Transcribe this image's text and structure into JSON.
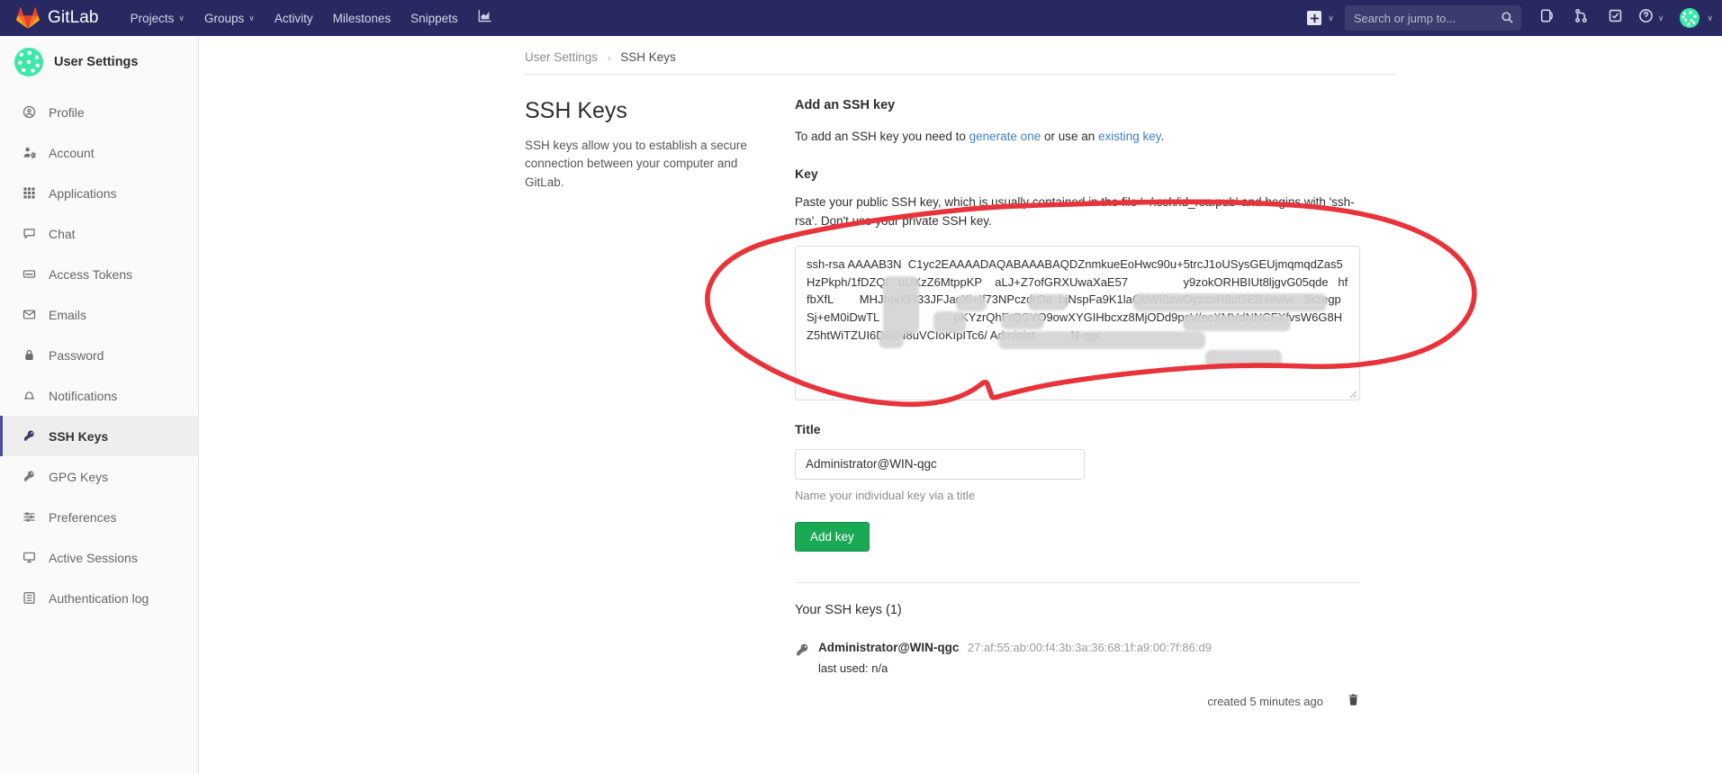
{
  "topnav": {
    "brand": "GitLab",
    "brand_logo_icon": "gitlab-tanuki-logo",
    "items": [
      {
        "label": "Projects",
        "caret": "∨"
      },
      {
        "label": "Groups",
        "caret": "∨"
      },
      {
        "label": "Activity",
        "caret": ""
      },
      {
        "label": "Milestones",
        "caret": ""
      },
      {
        "label": "Snippets",
        "caret": ""
      }
    ],
    "analytics_icon": "bar-chart-icon",
    "plus_icon": "plus-square-icon",
    "plus_caret": "∨",
    "search": {
      "value": "",
      "placeholder": "Search or jump to..."
    },
    "right_icons": [
      {
        "name": "issues-icon"
      },
      {
        "name": "merge-requests-icon"
      },
      {
        "name": "todos-icon"
      },
      {
        "name": "help-icon"
      }
    ],
    "help_caret": "∨",
    "avatar_caret": "∨",
    "colors": {
      "nav_bg": "#292961",
      "search_bg": "#3b3b6d",
      "avatar": "#3ce8a8"
    }
  },
  "sidebar": {
    "title": "User Settings",
    "avatar_icon": "user-identicon-avatar",
    "items": [
      {
        "label": "Profile",
        "icon": "user-circle-icon",
        "active": false
      },
      {
        "label": "Account",
        "icon": "account-gear-icon",
        "active": false
      },
      {
        "label": "Applications",
        "icon": "applications-grid-icon",
        "active": false
      },
      {
        "label": "Chat",
        "icon": "chat-bubble-icon",
        "active": false
      },
      {
        "label": "Access Tokens",
        "icon": "token-card-icon",
        "active": false
      },
      {
        "label": "Emails",
        "icon": "envelope-icon",
        "active": false
      },
      {
        "label": "Password",
        "icon": "lock-icon",
        "active": false
      },
      {
        "label": "Notifications",
        "icon": "bell-icon",
        "active": false
      },
      {
        "label": "SSH Keys",
        "icon": "key-icon",
        "active": true
      },
      {
        "label": "GPG Keys",
        "icon": "key-outline-icon",
        "active": false
      },
      {
        "label": "Preferences",
        "icon": "sliders-icon",
        "active": false
      },
      {
        "label": "Active Sessions",
        "icon": "monitor-icon",
        "active": false
      },
      {
        "label": "Authentication log",
        "icon": "log-list-icon",
        "active": false
      }
    ],
    "active_accent": "#4b4ba3"
  },
  "breadcrumb": {
    "parent": "User Settings",
    "separator": "›",
    "current": "SSH Keys"
  },
  "left": {
    "heading": "SSH Keys",
    "description": "SSH keys allow you to establish a secure connection between your computer and GitLab."
  },
  "form": {
    "heading": "Add an SSH key",
    "intro_pre": "To add an SSH key you need to ",
    "intro_link1": "generate one",
    "intro_mid": " or use an ",
    "intro_link2": "existing key",
    "intro_post": ".",
    "key_label": "Key",
    "key_hint": "Paste your public SSH key, which is usually contained in the file '~/.ssh/id_rsa.pub' and begins with 'ssh-rsa'. Don't use your private SSH key.",
    "key_value": "ssh-rsa AAAAB3N  C1yc2EAAAADAQABAAABAQDZnmkueEoHwc90u+5trcJ1oUSysGEUjmqmqdZas5HzPkph/1fDZQI   uUXzZ6MtppKP    aLJ+Z7ofGRXUwaXaE57                 y9zokORHBIUt8ljgvG05qde   hffbXfL        MHJhpiXFI33JFJacXi+If73NPczdrOa  bjNspFa9K1laObWI0zwOyzzuH8uI5EB4ov/w   3xzegpSj+eM0iDwTL                       pKYzrQhFrQSYO9owXYGIHbcxz8MjODd9pcV/ecXMVdNNCFXfvsW6G8HZ5htWiTZUI6D6aN8uVCIoKIpITc6/ Administ           N-qgc",
    "title_label": "Title",
    "title_value": "Administrator@WIN-qgc",
    "title_placeholder": "",
    "title_hint": "Name your individual key via a title",
    "submit_label": "Add key",
    "submit_color": "#1aaa55"
  },
  "keys_section": {
    "heading": "Your SSH keys (1)",
    "rows": [
      {
        "icon": "key-icon",
        "name": "Administrator@WIN-qgc",
        "fingerprint": "27:af:55:ab:00:f4:3b:3a:36:68:1f:a9:00:7f:86:d9",
        "last_used_label": "last used: n/a",
        "created": "created 5 minutes ago",
        "delete_icon": "trash-icon"
      }
    ]
  },
  "annotation": {
    "shape": "hand-drawn-ellipse",
    "color": "#e8333a",
    "target": "ssh-key-textarea"
  }
}
